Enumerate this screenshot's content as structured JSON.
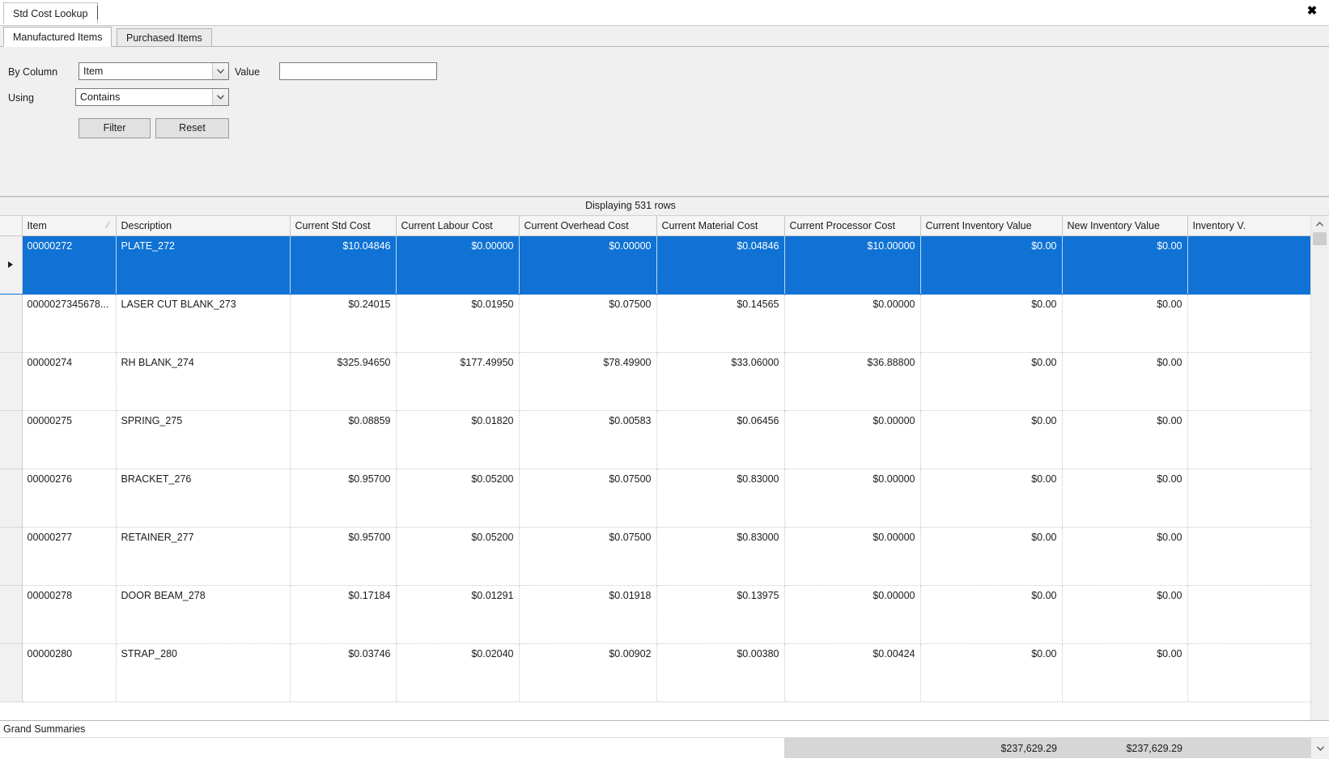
{
  "window": {
    "document_tab": "Std Cost Lookup",
    "close_icon": "close-icon"
  },
  "tabs": [
    {
      "label": "Manufactured Items",
      "selected": true
    },
    {
      "label": "Purchased Items",
      "selected": false
    }
  ],
  "filter_panel": {
    "by_column_label": "By Column",
    "by_column_value": "Item",
    "value_label": "Value",
    "value_text": "",
    "value_placeholder": "",
    "using_label": "Using",
    "using_value": "Contains",
    "filter_button": "Filter",
    "reset_button": "Reset"
  },
  "grid": {
    "caption": "Displaying 531 rows",
    "sort_glyph": "/",
    "columns": [
      "Item",
      "Description",
      "Current Std Cost",
      "Current Labour Cost",
      "Current Overhead Cost",
      "Current Material Cost",
      "Current Processor Cost",
      "Current Inventory Value",
      "New Inventory Value",
      "Inventory V."
    ],
    "rows": [
      {
        "selected": true,
        "item": "00000272",
        "description": "PLATE_272",
        "current_std_cost": "$10.04846",
        "current_labour_cost": "$0.00000",
        "current_overhead_cost": "$0.00000",
        "current_material_cost": "$0.04846",
        "current_processor_cost": "$10.00000",
        "current_inventory_value": "$0.00",
        "new_inventory_value": "$0.00",
        "inventory_v": ""
      },
      {
        "selected": false,
        "item": "0000027345678...",
        "description": "LASER CUT BLANK_273",
        "current_std_cost": "$0.24015",
        "current_labour_cost": "$0.01950",
        "current_overhead_cost": "$0.07500",
        "current_material_cost": "$0.14565",
        "current_processor_cost": "$0.00000",
        "current_inventory_value": "$0.00",
        "new_inventory_value": "$0.00",
        "inventory_v": ""
      },
      {
        "selected": false,
        "item": "00000274",
        "description": "RH BLANK_274",
        "current_std_cost": "$325.94650",
        "current_labour_cost": "$177.49950",
        "current_overhead_cost": "$78.49900",
        "current_material_cost": "$33.06000",
        "current_processor_cost": "$36.88800",
        "current_inventory_value": "$0.00",
        "new_inventory_value": "$0.00",
        "inventory_v": ""
      },
      {
        "selected": false,
        "item": "00000275",
        "description": "SPRING_275",
        "current_std_cost": "$0.08859",
        "current_labour_cost": "$0.01820",
        "current_overhead_cost": "$0.00583",
        "current_material_cost": "$0.06456",
        "current_processor_cost": "$0.00000",
        "current_inventory_value": "$0.00",
        "new_inventory_value": "$0.00",
        "inventory_v": ""
      },
      {
        "selected": false,
        "item": "00000276",
        "description": "BRACKET_276",
        "current_std_cost": "$0.95700",
        "current_labour_cost": "$0.05200",
        "current_overhead_cost": "$0.07500",
        "current_material_cost": "$0.83000",
        "current_processor_cost": "$0.00000",
        "current_inventory_value": "$0.00",
        "new_inventory_value": "$0.00",
        "inventory_v": ""
      },
      {
        "selected": false,
        "item": "00000277",
        "description": "RETAINER_277",
        "current_std_cost": "$0.95700",
        "current_labour_cost": "$0.05200",
        "current_overhead_cost": "$0.07500",
        "current_material_cost": "$0.83000",
        "current_processor_cost": "$0.00000",
        "current_inventory_value": "$0.00",
        "new_inventory_value": "$0.00",
        "inventory_v": ""
      },
      {
        "selected": false,
        "item": "00000278",
        "description": "DOOR BEAM_278",
        "current_std_cost": "$0.17184",
        "current_labour_cost": "$0.01291",
        "current_overhead_cost": "$0.01918",
        "current_material_cost": "$0.13975",
        "current_processor_cost": "$0.00000",
        "current_inventory_value": "$0.00",
        "new_inventory_value": "$0.00",
        "inventory_v": ""
      },
      {
        "selected": false,
        "item": "00000280",
        "description": "STRAP_280",
        "current_std_cost": "$0.03746",
        "current_labour_cost": "$0.02040",
        "current_overhead_cost": "$0.00902",
        "current_material_cost": "$0.00380",
        "current_processor_cost": "$0.00424",
        "current_inventory_value": "$0.00",
        "new_inventory_value": "$0.00",
        "inventory_v": ""
      }
    ]
  },
  "grand_summaries": {
    "title": "Grand Summaries",
    "current_inventory_value_total": "$237,629.29",
    "new_inventory_value_total": "$237,629.29"
  },
  "colors": {
    "selection": "#0f72d4",
    "panel": "#f0f0f0",
    "summary_fill": "#d6d6d6"
  }
}
